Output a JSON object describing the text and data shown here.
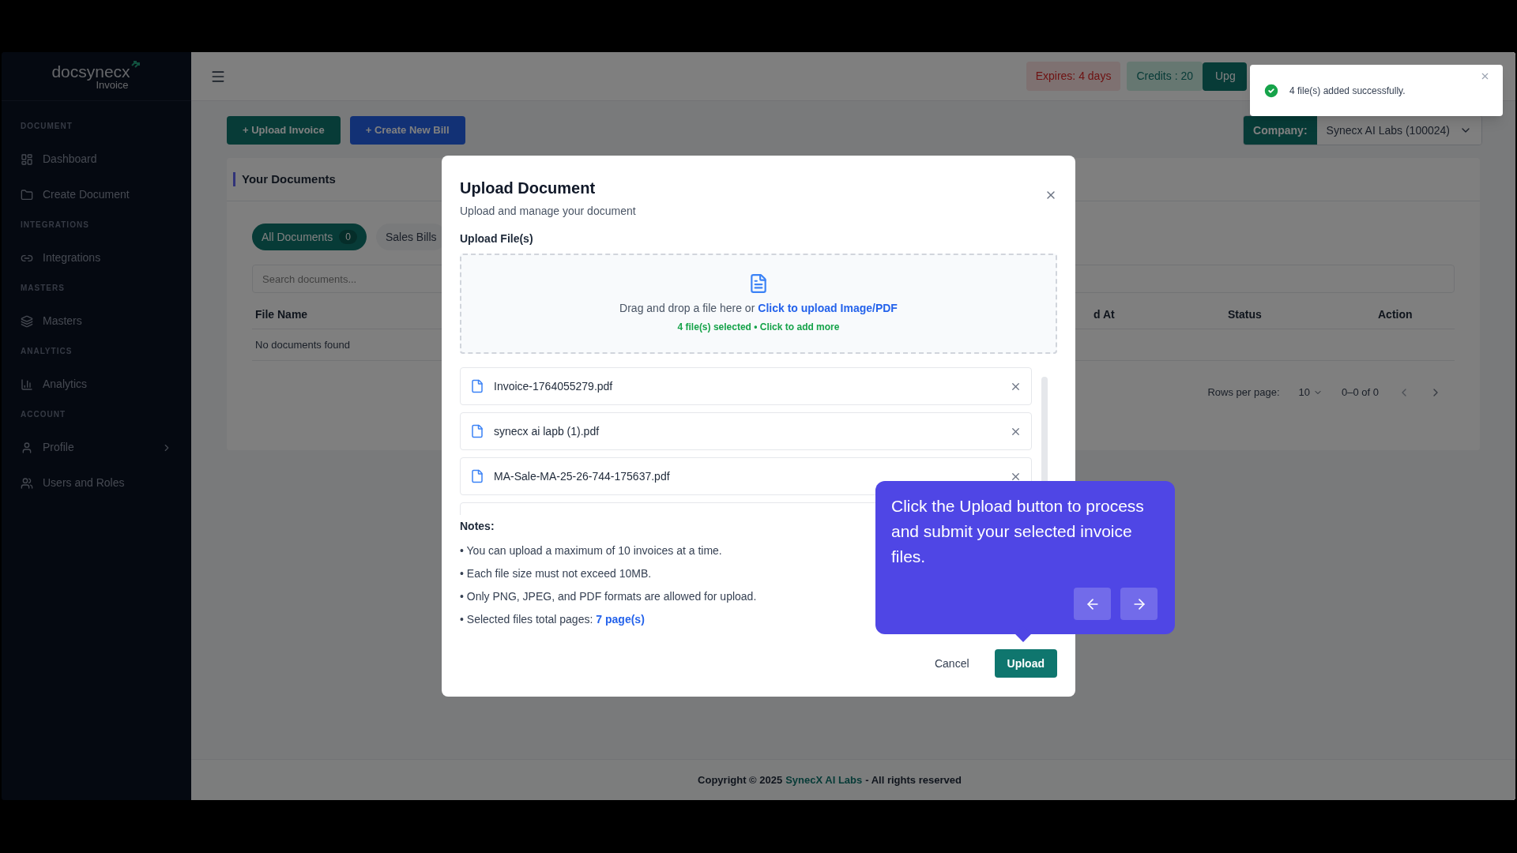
{
  "sidebar": {
    "logo": {
      "name": "docsynecx",
      "sub": "Invoice"
    },
    "sections": [
      {
        "heading": "DOCUMENT",
        "items": [
          {
            "label": "Dashboard",
            "kind": "link"
          },
          {
            "label": "Create Document",
            "kind": "link"
          }
        ]
      },
      {
        "heading": "INTEGRATIONS",
        "items": [
          {
            "label": "Integrations",
            "kind": "link"
          }
        ]
      },
      {
        "heading": "MASTERS",
        "items": [
          {
            "label": "Masters",
            "kind": "link"
          }
        ]
      },
      {
        "heading": "ANALYTICS",
        "items": [
          {
            "label": "Analytics",
            "kind": "link"
          }
        ]
      },
      {
        "heading": "ACCOUNT",
        "items": [
          {
            "label": "Profile",
            "kind": "group"
          },
          {
            "label": "Users and Roles",
            "kind": "link"
          }
        ]
      }
    ]
  },
  "topbar": {
    "expiry": "Expires: 4 days",
    "credits": "Credits : 20",
    "upgrade": "Upg"
  },
  "toolbar": {
    "buttons": [
      "+ Upload Invoice",
      "+ Create New Bill"
    ],
    "company": {
      "label": "Company:",
      "value": "Synecx AI Labs (100024)"
    }
  },
  "documents": {
    "title": "Your Documents",
    "tabs": [
      {
        "label": "All Documents",
        "count": "0",
        "selected": true
      },
      {
        "label": "Sales Bills",
        "selected": false
      }
    ],
    "search": {
      "placeholder": "Search documents..."
    },
    "columns": [
      "File Name",
      "d At",
      "Status",
      "Action"
    ],
    "empty": "No documents found",
    "pagination": {
      "rows_label": "Rows per page:",
      "rows_value": "10",
      "range": "0–0 of 0"
    }
  },
  "modal": {
    "title": "Upload Document",
    "subtitle": "Upload and manage your document",
    "upload_label": "Upload File(s)",
    "dropzone": {
      "prompt": "Drag and drop a file here or",
      "link": "Click to upload Image/PDF",
      "status": "4 file(s) selected • Click to add more"
    },
    "files": [
      "Invoice-1764055279.pdf",
      "synecx ai lapb (1).pdf",
      "MA-Sale-MA-25-26-744-175637.pdf"
    ],
    "notes_title": "Notes:",
    "notes": [
      "• You can upload a maximum of 10 invoices at a time.",
      "• Each file size must not exceed 10MB.",
      "• Only PNG, JPEG, and PDF formats are allowed for upload."
    ],
    "pages_note": {
      "text": "• Selected files total pages:",
      "value": "7 page(s)"
    },
    "cancel": "Cancel",
    "submit": "Upload"
  },
  "tooltip": {
    "text": "Click the Upload button to process and submit your selected invoice files."
  },
  "toast": {
    "text": "4 file(s) added successfully."
  },
  "footer": {
    "prefix": "Copyright © 2025",
    "link": "SynecX AI Labs",
    "suffix": "- All rights reserved"
  }
}
